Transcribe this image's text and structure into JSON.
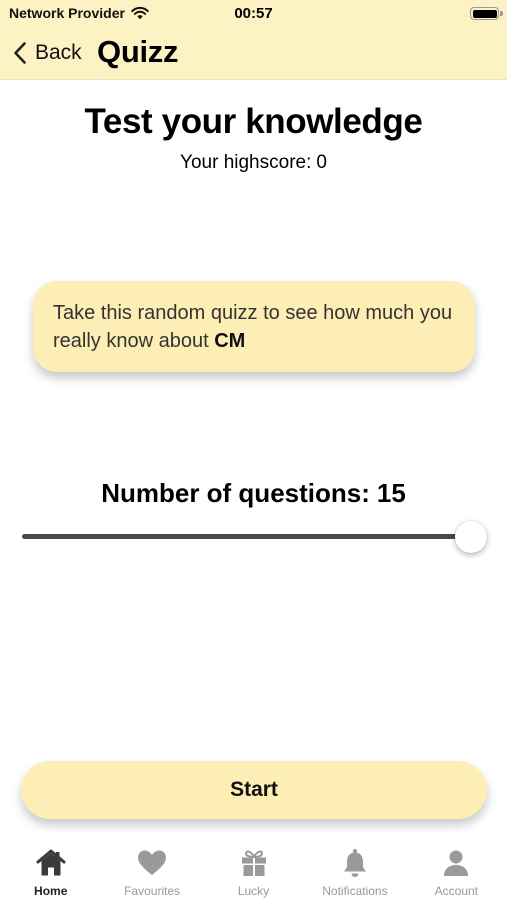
{
  "status_bar": {
    "carrier": "Network Provider",
    "time": "00:57"
  },
  "nav": {
    "back_label": "Back",
    "title": "Quizz"
  },
  "main": {
    "heading": "Test your knowledge",
    "highscore_label": "Your highscore:",
    "highscore_value": "0",
    "info_text": "Take this random quizz to see how much you really know about",
    "info_highlight": "CM",
    "questions_label": "Number of questions:",
    "questions_value": "15",
    "slider_level": 1.0,
    "start_label": "Start"
  },
  "tabs": [
    {
      "label": "Home",
      "icon": "home-icon",
      "active": true
    },
    {
      "label": "Favourites",
      "icon": "heart-icon",
      "active": false
    },
    {
      "label": "Lucky",
      "icon": "gift-icon",
      "active": false
    },
    {
      "label": "Notifications",
      "icon": "bell-icon",
      "active": false
    },
    {
      "label": "Account",
      "icon": "person-icon",
      "active": false
    }
  ],
  "colors": {
    "header_bg": "#fdf2c4",
    "card_bg": "#fdeeb5",
    "tab_active": "#3a3a3a",
    "tab_inactive": "#9a9a9a"
  }
}
